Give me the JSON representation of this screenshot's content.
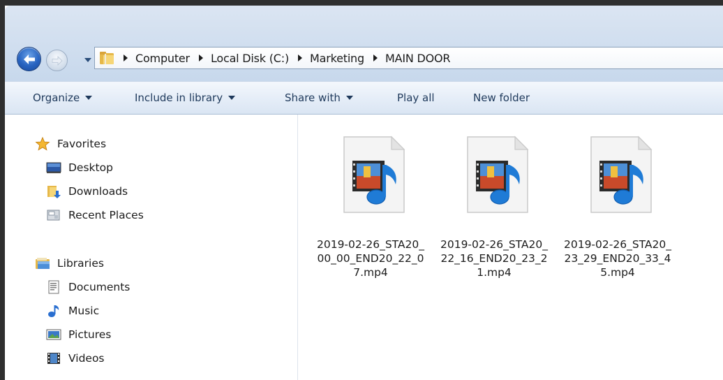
{
  "window": {
    "accent": "#2763c0",
    "frame_color": "#2f2f2f"
  },
  "nav": {
    "back_icon": "back-arrow-icon",
    "forward_icon": "forward-arrow-icon",
    "history_icon": "chevron-down-icon"
  },
  "address": {
    "root_icon": "folder-icon",
    "crumbs": [
      {
        "label": "Computer"
      },
      {
        "label": "Local Disk (C:)"
      },
      {
        "label": "Marketing"
      },
      {
        "label": "MAIN DOOR"
      }
    ]
  },
  "toolbar": {
    "organize": "Organize",
    "include_in_library": "Include in library",
    "share_with": "Share with",
    "play_all": "Play all",
    "new_folder": "New folder"
  },
  "sidebar": {
    "favorites": {
      "label": "Favorites",
      "icon": "star-icon",
      "items": [
        {
          "label": "Desktop",
          "icon": "desktop-icon"
        },
        {
          "label": "Downloads",
          "icon": "downloads-folder-icon"
        },
        {
          "label": "Recent Places",
          "icon": "recent-places-icon"
        }
      ]
    },
    "libraries": {
      "label": "Libraries",
      "icon": "libraries-icon",
      "items": [
        {
          "label": "Documents",
          "icon": "documents-icon"
        },
        {
          "label": "Music",
          "icon": "music-note-icon"
        },
        {
          "label": "Pictures",
          "icon": "pictures-icon"
        },
        {
          "label": "Videos",
          "icon": "videos-icon"
        }
      ]
    }
  },
  "files": [
    {
      "name": "2019-02-26_STA20_00_00_END20_22_07.mp4",
      "icon": "video-file-icon"
    },
    {
      "name": "2019-02-26_STA20_22_16_END20_23_21.mp4",
      "icon": "video-file-icon"
    },
    {
      "name": "2019-02-26_STA20_23_29_END20_33_45.mp4",
      "icon": "video-file-icon"
    }
  ]
}
